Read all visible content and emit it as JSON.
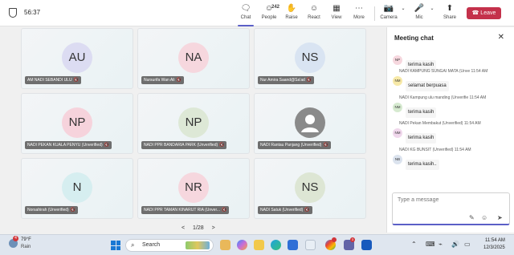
{
  "meeting": {
    "timer": "56:37",
    "toolbar": {
      "chat": "Chat",
      "people": "People",
      "people_count": "242",
      "raise": "Raise",
      "react": "React",
      "view": "View",
      "more": "More",
      "camera": "Camera",
      "mic": "Mic",
      "share": "Share",
      "leave": "Leave"
    },
    "participants": [
      {
        "initials": "AU",
        "name": "AM NADI SEBANDI ULU",
        "bg": "#dcdcf2"
      },
      {
        "initials": "NA",
        "name": "Nursurifa Wan Ali",
        "bg": "#f6d7de"
      },
      {
        "initials": "NS",
        "name": "Nur Amira Saand@Sa'ad",
        "bg": "#d9e4f2"
      },
      {
        "initials": "NP",
        "name": "NADI PEKAN KUALA PENYU (Unverified)",
        "bg": "#f6d3dc"
      },
      {
        "initials": "NP",
        "name": "NADI PPR BANDARIA PARK (Unverified)",
        "bg": "#dde8d6"
      },
      {
        "initials": "",
        "name": "NADI Rantau Panjang (Unverified)",
        "bg": "#8a8a8a"
      },
      {
        "initials": "N",
        "name": "Norsahirah (Unverified)",
        "bg": "#d6eef0"
      },
      {
        "initials": "NR",
        "name": "NADI PPR TAMAN KINARUT RIA (Unver...",
        "bg": "#f6d7de"
      },
      {
        "initials": "NS",
        "name": "NADI Satuk (Unverified)",
        "bg": "#dde6d4"
      }
    ],
    "pager": {
      "prev": "<",
      "label": "1/28",
      "next": ">"
    }
  },
  "chat": {
    "title": "Meeting chat",
    "messages": [
      {
        "meta": "",
        "initials": "NP",
        "av_bg": "#f6d7de",
        "text": "terima kasih"
      },
      {
        "meta": "NADI KAMPUNG SUNGAI MATA (Unve   11:54 AM",
        "initials": "NM",
        "av_bg": "#f7e9a8",
        "text": "selamat berpuasa"
      },
      {
        "meta": "NADI Kampung ulu manding (Unverifie   11:54 AM",
        "initials": "NM",
        "av_bg": "#d6ead0",
        "text": "terima kasih"
      },
      {
        "meta": "NADI Pekan Membakut (Unverified)   11:54 AM",
        "initials": "NM",
        "av_bg": "#f0d7ec",
        "text": "terima kasih"
      },
      {
        "meta": "NADI KG BUNSIT (Unverified)   11:54 AM",
        "initials": "NB",
        "av_bg": "#dbe3ee",
        "text": "terima kasih.."
      }
    ],
    "input_placeholder": "Type a message"
  },
  "taskbar": {
    "weather_temp": "79°F",
    "weather_cond": "Rain",
    "weather_badge": "4",
    "search_placeholder": "Search",
    "teams_badge": "3",
    "time": "11:54 AM",
    "date": "12/3/2025"
  }
}
